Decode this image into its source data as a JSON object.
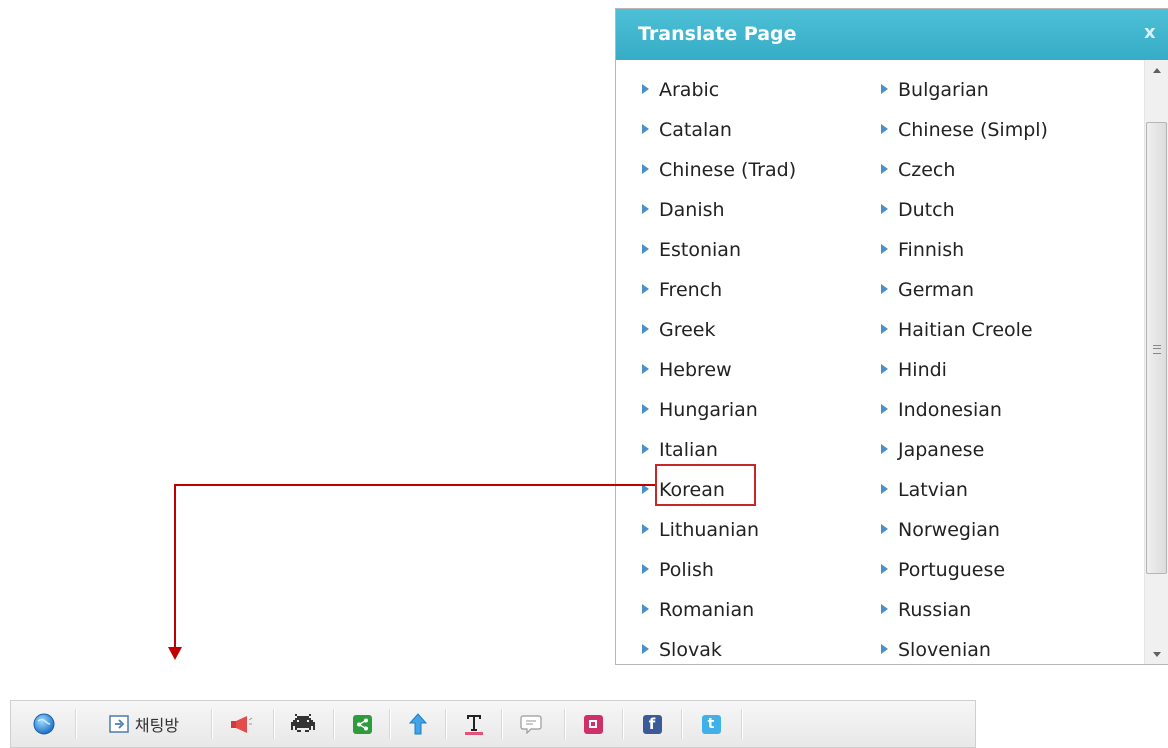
{
  "panel": {
    "title": "Translate Page",
    "close": "x",
    "languages_col1": [
      "Arabic",
      "Catalan",
      "Chinese (Trad)",
      "Danish",
      "Estonian",
      "French",
      "Greek",
      "Hebrew",
      "Hungarian",
      "Italian",
      "Korean",
      "Lithuanian",
      "Polish",
      "Romanian",
      "Slovak"
    ],
    "languages_col2": [
      "Bulgarian",
      "Chinese (Simpl)",
      "Czech",
      "Dutch",
      "Finnish",
      "German",
      "Haitian Creole",
      "Hindi",
      "Indonesian",
      "Japanese",
      "Latvian",
      "Norwegian",
      "Portuguese",
      "Russian",
      "Slovenian"
    ],
    "highlighted": "Korean"
  },
  "toolbar": {
    "chat_label": "채팅방",
    "icons": [
      "globe-icon",
      "chat-room-icon",
      "megaphone-icon",
      "invader-icon",
      "share-icon",
      "upload-arrow-icon",
      "text-format-icon",
      "speech-bubble-icon",
      "pink-square-icon",
      "facebook-icon",
      "twitter-icon"
    ]
  },
  "colors": {
    "header": "#3fb6cf",
    "arrow": "#c00000",
    "bullet": "#4a8fc7"
  }
}
